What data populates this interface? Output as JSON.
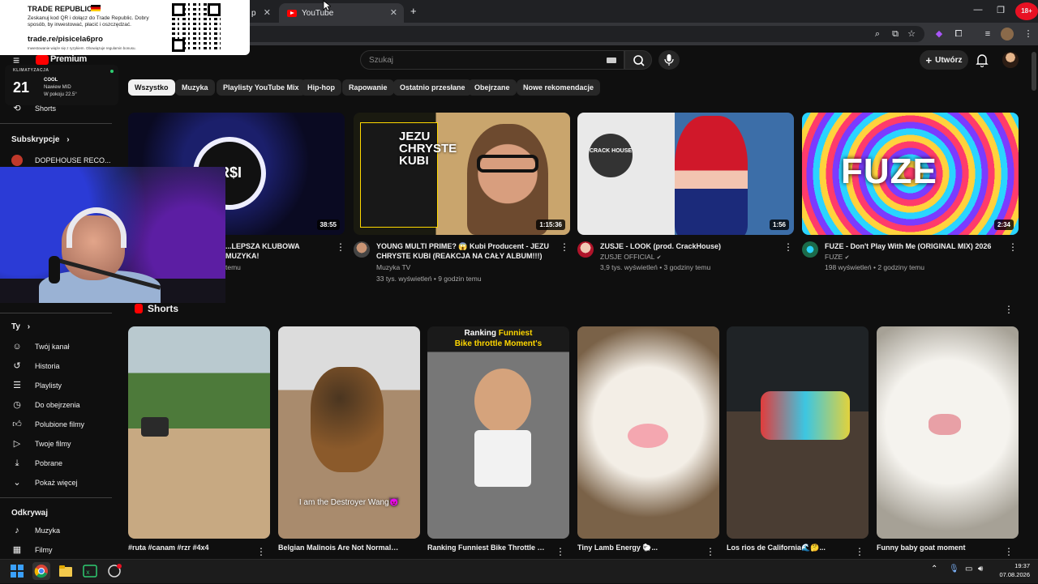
{
  "browser": {
    "tabs": [
      {
        "label": "p",
        "active": false
      },
      {
        "label": "YouTube",
        "active": true
      }
    ],
    "new_tab": "+"
  },
  "ad": {
    "title": "TRADE REPUBLIC",
    "body": "Zeskanuj kod QR i dołącz do Trade Republic. Dobry sposób, by inwestować, płacić i oszczędzać.",
    "link": "trade.re/pisicela6pro",
    "fine": "Inwestowanie wiąże się z ryzykiem. Obowiązuje regulamin bonusu."
  },
  "youtube": {
    "logo": "Premium",
    "search_placeholder": "Szukaj",
    "create": "Utwórz"
  },
  "klima": {
    "label": "KLIMATYZACJA",
    "temp": "21",
    "mode": "COOL",
    "fan": "Nawiew MID",
    "room": "W pokoju 22.5°"
  },
  "chips": [
    "Wszystko",
    "Muzyka",
    "Playlisty YouTube Mix",
    "Hip-hop",
    "Rapowanie",
    "Ostatnio przesłane",
    "Obejrzane",
    "Nowe rekomendacje"
  ],
  "sidebar": {
    "shorts": "Shorts",
    "subs_head": "Subskrypcje",
    "sub_item": "DOPEHOUSE RECO...",
    "you_head": "Ty",
    "you_items": [
      "Twój kanał",
      "Historia",
      "Playlisty",
      "Do obejrzenia",
      "Polubione filmy",
      "Twoje filmy",
      "Pobrane",
      "Pokaż więcej"
    ],
    "explore_head": "Odkrywaj",
    "explore_items": [
      "Muzyka",
      "Filmy"
    ]
  },
  "videos": [
    {
      "duration": "38:55",
      "title": "...LEPSZA KLUBOWA MUZYKA!",
      "channel": "",
      "meta": "temu"
    },
    {
      "duration": "1:15:36",
      "title": "YOUNG MULTI PRIME? 😱 Kubi Producent - JEZU CHRYSTE KUBI (REAKCJA NA CAŁY ALBUM!!!)",
      "channel": "Muzyka TV",
      "meta": "33 tys. wyświetleń • 9 godzin temu",
      "thumb_text": "JEZU CHRYSTE KUBI"
    },
    {
      "duration": "1:56",
      "title": "ZUSJE - LOOK (prod. CrackHouse)",
      "channel": "ZUSJE OFFICIAL",
      "meta": "3,9 tys. wyświetleń • 3 godziny temu",
      "thumb_text": "CRACK HOUSE"
    },
    {
      "duration": "2:34",
      "title": "FUZE - Don't Play With Me (ORIGINAL MIX) 2026",
      "channel": "FUZE",
      "meta": "198 wyświetleń • 2 godziny temu",
      "thumb_text": "FUZE"
    }
  ],
  "shorts_section": {
    "title": "Shorts",
    "items": [
      {
        "title": "#ruta #canam #rzr #4x4"
      },
      {
        "title": "Belgian Malinois Are Not Normal Dogs",
        "overlay": "I am the Destroyer Wang😈"
      },
      {
        "title": "Ranking Funniest Bike Throttle Moment's 😂",
        "top_a": "Ranking",
        "top_b": "Funniest",
        "top_c": "Bike throttle Moment's"
      },
      {
        "title": "Tiny Lamb Energy 🐑..."
      },
      {
        "title": "Los rios de California🌊🤔..."
      },
      {
        "title": "Funny baby goat moment"
      }
    ]
  },
  "taskbar": {
    "time": "19:37",
    "date": "07.08.2026"
  },
  "colors": {
    "yt_red": "#ff0000",
    "bg": "#0f0f0f",
    "chip": "#272727"
  }
}
